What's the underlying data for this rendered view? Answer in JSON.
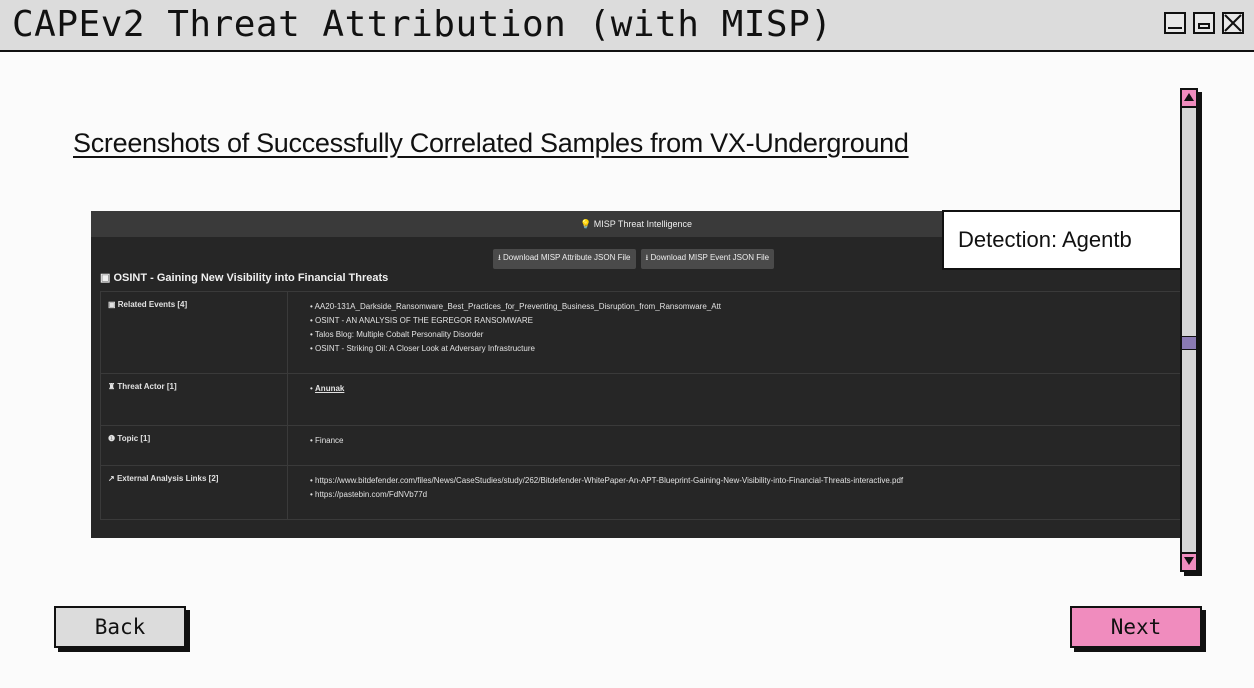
{
  "window": {
    "title": "CAPEv2 Threat Attribution (with MISP)"
  },
  "heading": "Screenshots of Successfully Correlated Samples from VX-Underground",
  "misp": {
    "header": "MISP Threat Intelligence",
    "download_attribute": "Download MISP Attribute JSON File",
    "download_event": "Download MISP Event JSON File",
    "event_title": "OSINT - Gaining New Visibility into Financial Threats",
    "rows": [
      {
        "key": "Related Events [4]",
        "icon": "calendar-icon",
        "values": [
          "AA20-131A_Darkside_Ransomware_Best_Practices_for_Preventing_Business_Disruption_from_Ransomware_Att",
          "OSINT - AN ANALYSIS OF THE EGREGOR RANSOMWARE",
          "Talos Blog: Multiple Cobalt Personality Disorder",
          "OSINT - Striking Oil: A Closer Look at Adversary Infrastructure"
        ]
      },
      {
        "key": "Threat Actor [1]",
        "icon": "user-secret-icon",
        "values": [
          "Anunak"
        ]
      },
      {
        "key": "Topic [1]",
        "icon": "info-icon",
        "values": [
          "Finance"
        ]
      },
      {
        "key": "External Analysis Links [2]",
        "icon": "external-link-icon",
        "values": [
          "https://www.bitdefender.com/files/News/CaseStudies/study/262/Bitdefender-WhitePaper-An-APT-Blueprint-Gaining-New-Visibility-into-Financial-Threats-interactive.pdf",
          "https://pastebin.com/FdNVb77d"
        ]
      }
    ]
  },
  "detection": "Detection: Agentb",
  "nav": {
    "back": "Back",
    "next": "Next"
  },
  "colors": {
    "accent": "#f08cbe",
    "thumb": "#8a7ab3",
    "titlebar": "#dcdcdc"
  }
}
